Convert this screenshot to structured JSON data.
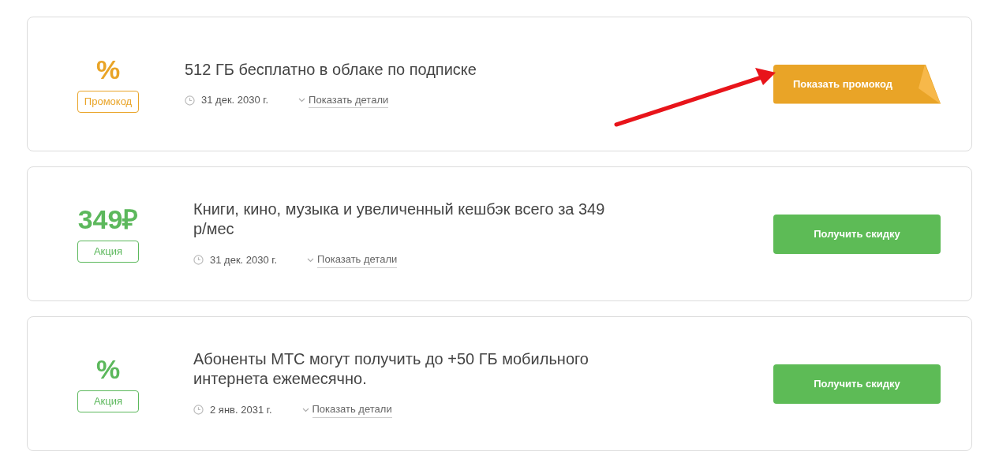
{
  "offers": [
    {
      "kind": "promo",
      "value": "%",
      "tag": "Промокод",
      "title": "512 ГБ бесплатно в облаке по подписке",
      "date": "31 дек. 2030 г.",
      "details": "Показать детали",
      "button": "Показать промокод",
      "pointer_arrow": true
    },
    {
      "kind": "deal",
      "value": "349₽",
      "tag": "Акция",
      "title": "Книги, кино, музыка и увеличенный кешбэк всего за 349 р/мес",
      "date": "31 дек. 2030 г.",
      "details": "Показать детали",
      "button": "Получить скидку",
      "pointer_arrow": false
    },
    {
      "kind": "deal",
      "value": "%",
      "tag": "Акция",
      "title": "Абоненты МТС могут получить до +50 ГБ мобильного интернета ежемесячно.",
      "date": "2 янв. 2031 г.",
      "details": "Показать детали",
      "button": "Получить скидку",
      "pointer_arrow": false
    }
  ]
}
